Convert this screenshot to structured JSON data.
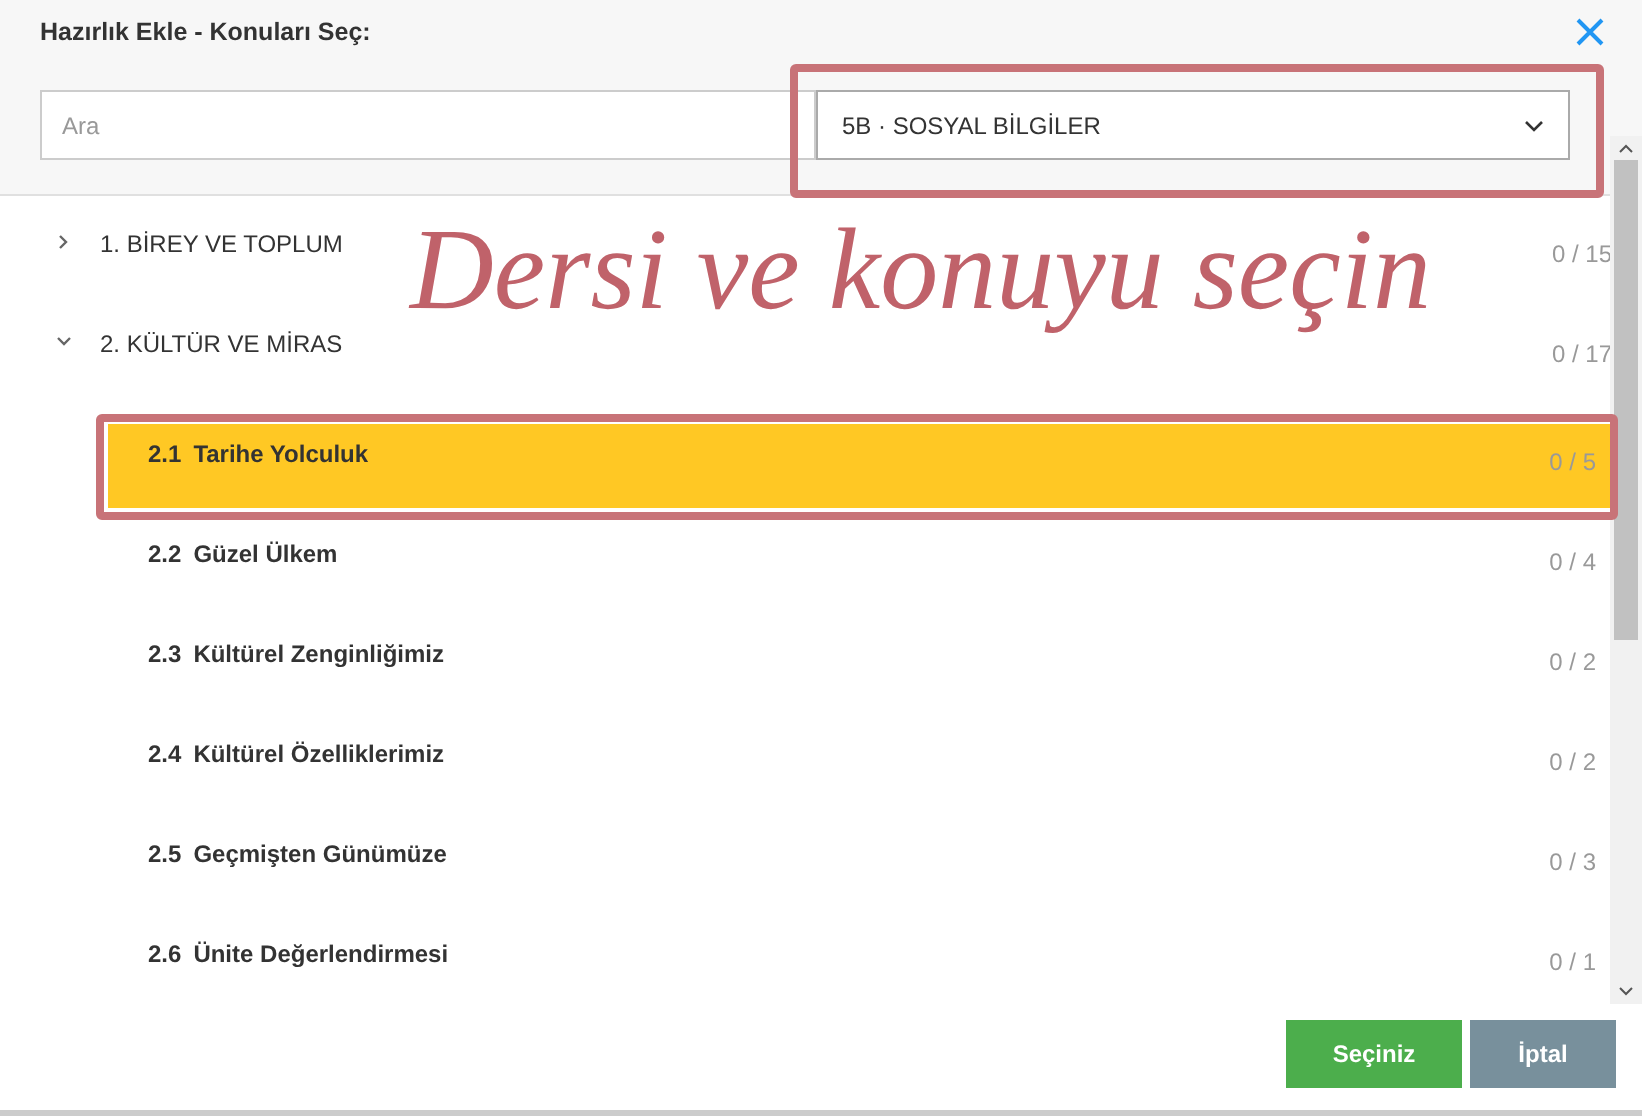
{
  "dialog": {
    "title": "Hazırlık Ekle - Konuları Seç:"
  },
  "search": {
    "placeholder": "Ara"
  },
  "course_select": {
    "value": "5B · SOSYAL BİLGİLER",
    "highlighted": true
  },
  "annotation": {
    "text": "Dersi ve konuyu seçin"
  },
  "topics": [
    {
      "title": "1. BİREY VE TOPLUM",
      "count": "0 / 15",
      "expanded": false
    },
    {
      "title": "2. KÜLTÜR VE MİRAS",
      "count": "0 / 17",
      "expanded": true,
      "children": [
        {
          "number": "2.1",
          "title": "Tarihe Yolculuk",
          "count": "0 / 5",
          "selected": true
        },
        {
          "number": "2.2",
          "title": "Güzel Ülkem",
          "count": "0 / 4",
          "selected": false
        },
        {
          "number": "2.3",
          "title": "Kültürel Zenginliğimiz",
          "count": "0 / 2",
          "selected": false
        },
        {
          "number": "2.4",
          "title": "Kültürel Özelliklerimiz",
          "count": "0 / 2",
          "selected": false
        },
        {
          "number": "2.5",
          "title": "Geçmişten Günümüze",
          "count": "0 / 3",
          "selected": false
        },
        {
          "number": "2.6",
          "title": "Ünite Değerlendirmesi",
          "count": "0 / 1",
          "selected": false
        }
      ]
    }
  ],
  "buttons": [
    {
      "label": "Seçiniz",
      "kind": "primary"
    },
    {
      "label": "İptal",
      "kind": "cancel"
    }
  ]
}
